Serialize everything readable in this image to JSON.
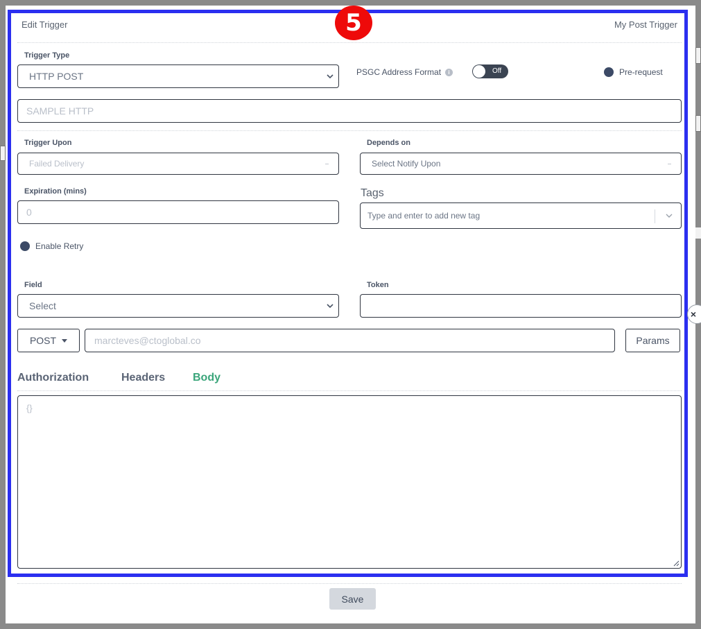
{
  "step_badge": "5",
  "header": {
    "title": "Edit Trigger",
    "trigger_name": "My Post Trigger"
  },
  "trigger_type": {
    "label": "Trigger Type",
    "value": "HTTP POST"
  },
  "psgc": {
    "label": "PSGC Address Format",
    "info_glyph": "i",
    "toggle_text": "Off"
  },
  "pre_request": {
    "label": "Pre-request"
  },
  "name_field": {
    "placeholder": "SAMPLE HTTP"
  },
  "trigger_upon": {
    "label": "Trigger Upon",
    "value": "Failed Delivery",
    "caret": "-"
  },
  "depends_on": {
    "label": "Depends on",
    "value": "Select Notify Upon",
    "caret": "-"
  },
  "expiration": {
    "label": "Expiration (mins)",
    "placeholder": "0"
  },
  "tags": {
    "label": "Tags",
    "placeholder": "Type and enter to add new tag"
  },
  "enable_retry": {
    "label": "Enable Retry"
  },
  "field": {
    "label": "Field",
    "value": "Select"
  },
  "token": {
    "label": "Token",
    "value": ""
  },
  "request": {
    "method": "POST",
    "url_placeholder": "marcteves@ctoglobal.co",
    "params_label": "Params"
  },
  "tabs": [
    {
      "label": "Authorization",
      "active": false
    },
    {
      "label": "Headers",
      "active": false
    },
    {
      "label": "Body",
      "active": true
    }
  ],
  "body": {
    "placeholder": "{}"
  },
  "close_glyph": "×",
  "save_label": "Save",
  "colors": {
    "highlight": "#2b2ff0",
    "badge": "#ee0a0a",
    "active_tab": "#3aa57a",
    "radio": "#3c4a66"
  }
}
